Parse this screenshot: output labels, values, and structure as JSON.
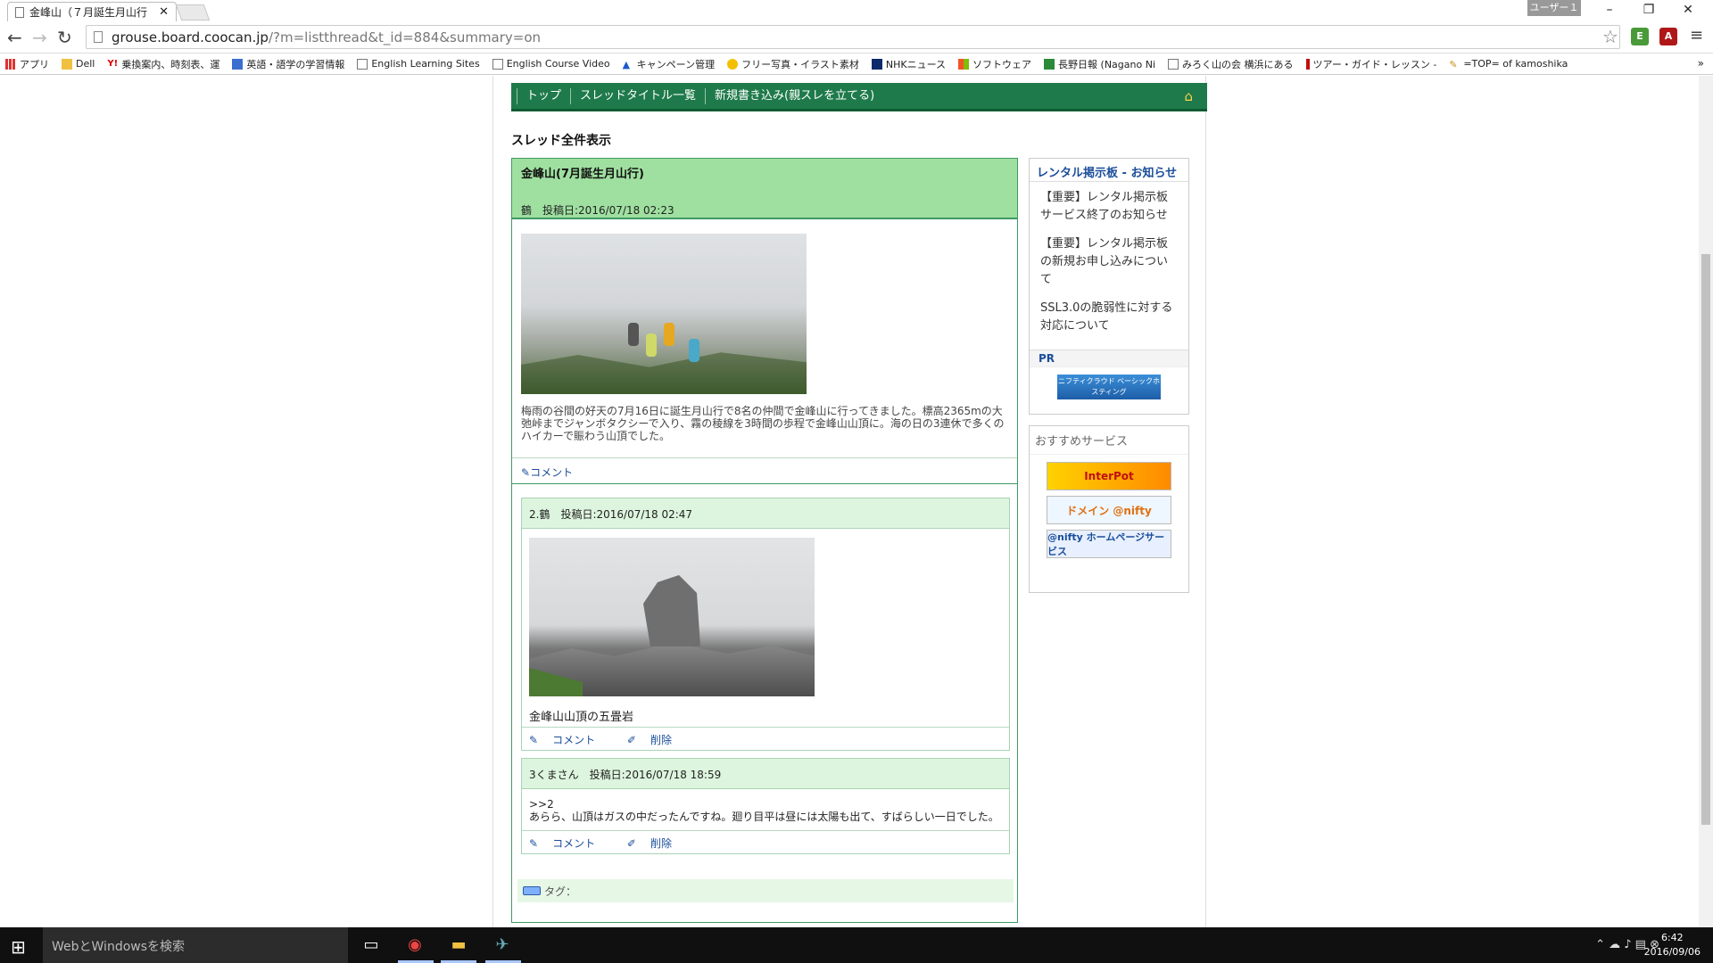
{
  "browser": {
    "tab_title": "金峰山（７月誕生月山行",
    "user_badge": "ユーザー１",
    "url_host": "grouse.board.coocan.jp",
    "url_path": "/?m=listthread&t_id=884&summary=on",
    "bookmarks": [
      "アプリ",
      "Dell",
      "乗換案内、時刻表、運",
      "英語・語学の学習情報",
      "English Learning Sites",
      "English Course Video",
      "キャンペーン管理",
      "フリー写真・イラスト素材",
      "NHKニュース",
      "ソフトウェア",
      "長野日報 (Nagano Ni",
      "みろく山の会 横浜にある",
      "ツアー・ガイド・レッスン -",
      "=TOP= of kamoshika"
    ],
    "ext_icons": [
      "evernote-icon",
      "acrobat-icon"
    ]
  },
  "nav": {
    "top": "トップ",
    "thread_list": "スレッドタイトル一覧",
    "new_post": "新規書き込み(親スレを立てる)"
  },
  "page": {
    "heading": "スレッド全件表示",
    "thread": {
      "title": "金峰山(7月誕生月山行)",
      "meta": "鶴　投稿日:2016/07/18 02:23",
      "body": "梅雨の谷間の好天の7月16日に誕生月山行で8名の仲間で金峰山に行ってきました。標高2365mの大弛峠までジャンボタクシーで入り、霧の稜線を3時間の歩程で金峰山山頂に。海の日の3連休で多くのハイカーで賑わう山頂でした。",
      "comment": "コメント"
    },
    "replies": [
      {
        "meta": "2.鶴　投稿日:2016/07/18 02:47",
        "caption": "金峰山山頂の五畳岩",
        "comment": "コメント",
        "delete": "削除"
      },
      {
        "meta": "3くまさん　投稿日:2016/07/18 18:59",
        "quote": ">>2",
        "text": "あらら、山頂はガスの中だったんですね。廻り目平は昼には太陽も出て、すばらしい一日でした。",
        "comment": "コメント",
        "delete": "削除"
      }
    ],
    "tag_label": "タグ："
  },
  "sidebar": {
    "notice_title": "レンタル掲示板 - お知らせ",
    "notices": [
      "【重要】レンタル掲示板サービス終了のお知らせ",
      "【重要】レンタル掲示板の新規お申し込みについて",
      "SSL3.0の脆弱性に対する対応について"
    ],
    "pr_label": "PR",
    "pr_banner": "ニフティクラウド ベーシックホスティング",
    "rec_title": "おすすめサービス",
    "rec_banners": [
      "InterPot",
      "ドメイン @nifty",
      "@nifty ホームページサービス"
    ]
  },
  "taskbar": {
    "search_placeholder": "WebとWindowsを検索",
    "time": "6:42",
    "date": "2016/09/06"
  }
}
